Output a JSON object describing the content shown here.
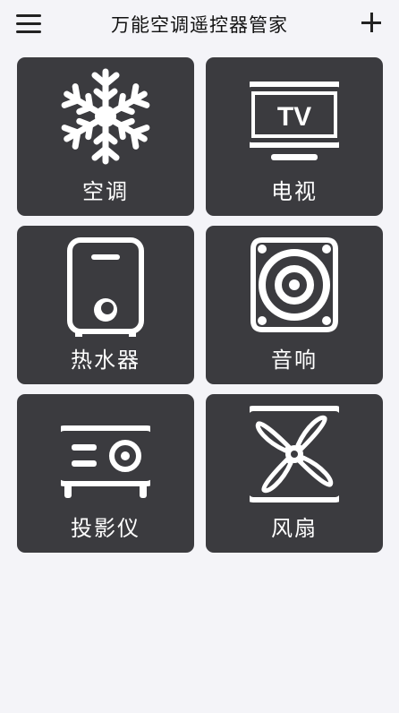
{
  "header": {
    "title": "万能空调遥控器管家",
    "menu_icon": "hamburger-menu-icon",
    "add_icon": "plus-icon"
  },
  "devices": [
    {
      "label": "空调",
      "icon": "snowflake-icon"
    },
    {
      "label": "电视",
      "icon": "tv-icon",
      "icon_text": "TV"
    },
    {
      "label": "热水器",
      "icon": "water-heater-icon"
    },
    {
      "label": "音响",
      "icon": "speaker-icon"
    },
    {
      "label": "投影仪",
      "icon": "projector-icon"
    },
    {
      "label": "风扇",
      "icon": "fan-icon"
    }
  ],
  "colors": {
    "background": "#f4f4f8",
    "tile": "#3b3b3f",
    "tile_text": "#ffffff"
  }
}
